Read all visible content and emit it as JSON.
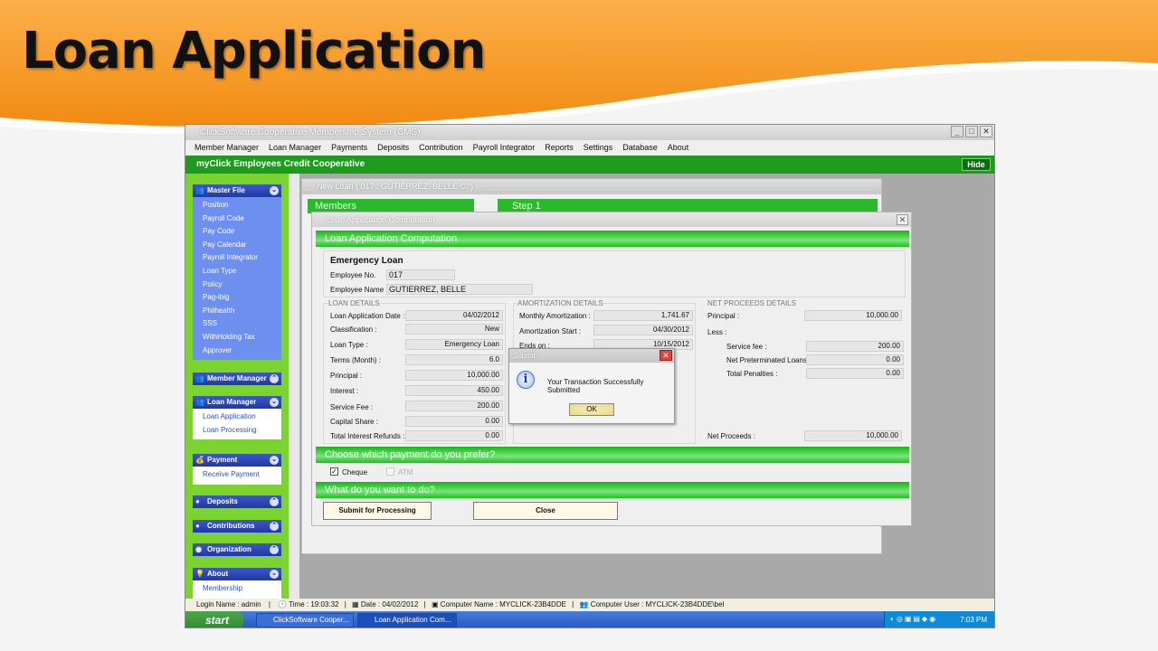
{
  "slide": {
    "title": "Loan Application"
  },
  "window": {
    "title": "ClickSoftware Cooperative Membership System (CMS)",
    "menu": [
      "Member Manager",
      "Loan Manager",
      "Payments",
      "Deposits",
      "Contribution",
      "Payroll Integrator",
      "Reports",
      "Settings",
      "Database",
      "About"
    ],
    "org_name": "myClick Employees Credit Cooperative",
    "hide_label": "Hide"
  },
  "sidebar": {
    "master_file": {
      "label": "Master File",
      "items": [
        "Position",
        "Payroll Code",
        "Pay Code",
        "Pay Calendar",
        "Payroll Integrator",
        "Loan Type",
        "Policy",
        "Pag-ibig",
        "Philhealth",
        "SSS",
        "WithHolding Tax",
        "Approver"
      ]
    },
    "member_manager": {
      "label": "Member Manager"
    },
    "loan_manager": {
      "label": "Loan Manager",
      "items": [
        "Loan Application",
        "Loan Processing"
      ]
    },
    "payment": {
      "label": "Payment",
      "items": [
        "Receive Payment"
      ]
    },
    "deposits": {
      "label": "Deposits"
    },
    "contributions": {
      "label": "Contributions"
    },
    "organization": {
      "label": "Organization"
    },
    "about": {
      "label": "About",
      "items": [
        "Membership"
      ]
    }
  },
  "new_loan": {
    "title": "New Loan ( 017 : GUTIERREZ, BELLE C. )",
    "members_tab": "Members",
    "step_tab": "Step 1"
  },
  "dialog": {
    "title": "Loan Application Computation",
    "header": "Loan Application Computation",
    "loan_name": "Emergency Loan",
    "employee_no_label": "Employee No.",
    "employee_no": "017",
    "employee_name_label": "Employee Name",
    "employee_name": "GUTIERREZ, BELLE",
    "loan_details": {
      "title": "LOAN DETAILS",
      "rows": [
        {
          "label": "Loan Application Date :",
          "value": "04/02/2012"
        },
        {
          "label": "Classification :",
          "value": "New"
        },
        {
          "label": "Loan Type :",
          "value": "Emergency Loan"
        },
        {
          "label": "Terms (Month) :",
          "value": "6.0"
        },
        {
          "label": "Principal :",
          "value": "10,000.00"
        },
        {
          "label": "Interest :",
          "value": "450.00"
        },
        {
          "label": "Service Fee :",
          "value": "200.00"
        },
        {
          "label": "Capital Share :",
          "value": "0.00"
        },
        {
          "label": "Total Interest Refunds :",
          "value": "0.00"
        }
      ]
    },
    "amortization": {
      "title": "AMORTIZATION DETAILS",
      "rows": [
        {
          "label": "Monthly Amortization :",
          "value": "1,741.67"
        },
        {
          "label": "Amortization Start :",
          "value": "04/30/2012"
        },
        {
          "label": "Ends on :",
          "value": "10/15/2012"
        }
      ]
    },
    "net_proceeds": {
      "title": "NET PROCEEDS DETAILS",
      "principal_label": "Principal :",
      "principal": "10,000.00",
      "less_label": "Less :",
      "rows": [
        {
          "label": "Service fee :",
          "value": "200.00"
        },
        {
          "label": "Net Preterminated Loans :",
          "value": "0.00"
        },
        {
          "label": "Total Penalties :",
          "value": "0.00"
        }
      ],
      "net_label": "Net Proceeds :",
      "net_value": "10,000.00"
    },
    "payment_header": "Choose which payment do you prefer?",
    "cheque_label": "Cheque",
    "atm_label": "ATM",
    "action_header": "What do you want to do?",
    "submit_label": "Submit for Processing",
    "close_label": "Close"
  },
  "msgbox": {
    "title": "Submit",
    "message": "Your Transaction Successfully Submitted",
    "ok_label": "OK"
  },
  "statusbar": {
    "login": "Login Name : admin",
    "time": "Time : 19:03:32",
    "date": "Date : 04/02/2012",
    "computer": "Computer Name : MYCLICK-23B4DDE",
    "user": "Computer User : MYCLICK-23B4DDE\\bel"
  },
  "taskbar": {
    "start": "start",
    "task1": "ClickSoftware Cooper...",
    "task2": "Loan Application Com...",
    "clock": "7:03 PM"
  },
  "colors": {
    "accent_orange": "#f7941d",
    "green": "#1e9b1e",
    "sidebar_green": "#7ad32e",
    "nav_blue": "#1f3aa5"
  }
}
